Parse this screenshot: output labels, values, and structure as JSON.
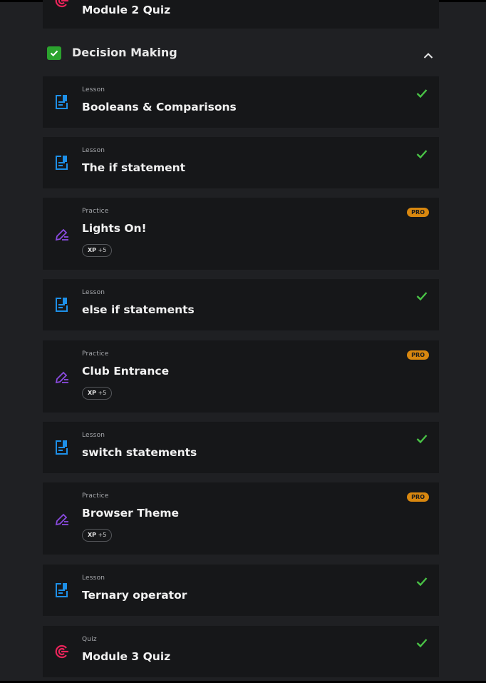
{
  "prev_item": {
    "type": "",
    "title": "Module 2 Quiz"
  },
  "section": {
    "title": "Decision Making",
    "icon": "check-square-icon",
    "accent": "#2ba32e"
  },
  "items": [
    {
      "type": "Lesson",
      "title": "Booleans & Comparisons",
      "status": "check"
    },
    {
      "type": "Lesson",
      "title": "The if statement",
      "status": "check"
    },
    {
      "type": "Practice",
      "title": "Lights On!",
      "badge": "PRO",
      "xp_label": "XP",
      "xp_value": "+5"
    },
    {
      "type": "Lesson",
      "title": "else if statements",
      "status": "check"
    },
    {
      "type": "Practice",
      "title": "Club Entrance",
      "badge": "PRO",
      "xp_label": "XP",
      "xp_value": "+5"
    },
    {
      "type": "Lesson",
      "title": "switch statements",
      "status": "check"
    },
    {
      "type": "Practice",
      "title": "Browser Theme",
      "badge": "PRO",
      "xp_label": "XP",
      "xp_value": "+5"
    },
    {
      "type": "Lesson",
      "title": "Ternary operator",
      "status": "check"
    },
    {
      "type": "Quiz",
      "title": "Module 3 Quiz",
      "status": "check"
    }
  ],
  "colors": {
    "lesson": "#1e90e8",
    "practice": "#8a4be0",
    "quiz": "#e8245a",
    "check": "#49c246",
    "pro": "#d8870f"
  }
}
